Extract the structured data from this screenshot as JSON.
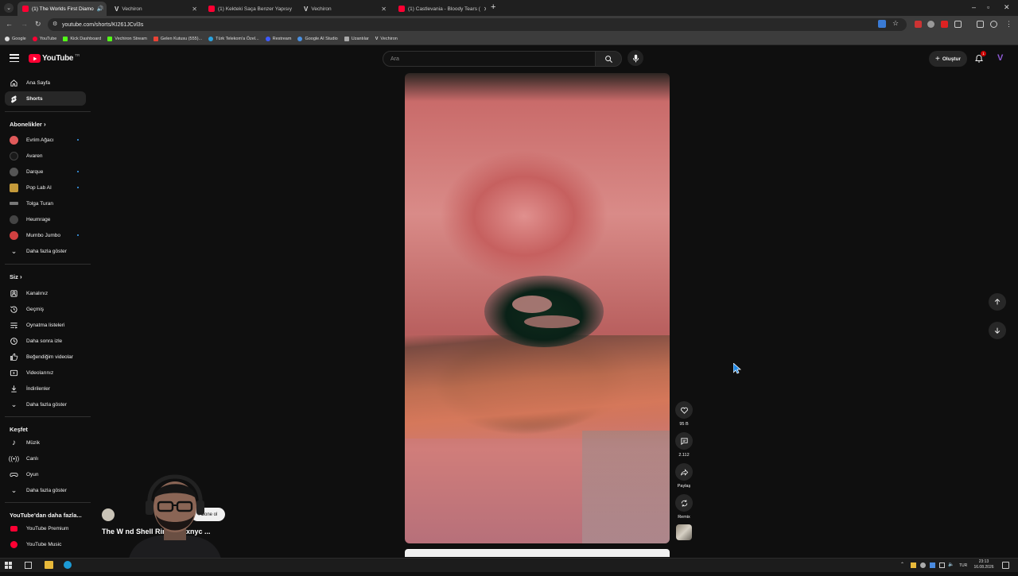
{
  "browser": {
    "tabs": [
      {
        "label": "(1) The Worlds First Diamo",
        "active": true
      },
      {
        "label": "Vechiron",
        "active": false
      },
      {
        "label": "(1) Kekteki Saça Benzer Yapısıy",
        "active": false
      },
      {
        "label": "Vechiron",
        "active": false
      },
      {
        "label": "(1) Castlevania - Bloody Tears (",
        "active": false
      }
    ],
    "url": "youtube.com/shorts/KI261JCvl3s",
    "bookmarks": [
      "Google",
      "YouTube",
      "Kick Dashboard",
      "Vechiron Stream",
      "Gelen Kutusu (555)...",
      "Türk Telekom'a Özel...",
      "Restream",
      "Google AI Studio",
      "Uzantılar",
      "Vechiron"
    ]
  },
  "youtube": {
    "logo": "YouTube",
    "logo_suffix": "TR",
    "search_placeholder": "Ara",
    "create_label": "Oluştur",
    "notification_count": "1"
  },
  "sidebar": {
    "main": [
      {
        "label": "Ana Sayfa",
        "icon": "home-icon"
      },
      {
        "label": "Shorts",
        "icon": "shorts-icon",
        "selected": true
      }
    ],
    "subscriptions_header": "Abonelikler",
    "subscriptions": [
      {
        "label": "Evrim Ağacı",
        "dot": true,
        "color": "#e05a5a"
      },
      {
        "label": "Avaren",
        "dot": false,
        "color": "#333333"
      },
      {
        "label": "Darque",
        "dot": true,
        "color": "#555555"
      },
      {
        "label": "Pop Lab AI",
        "dot": true,
        "color": "#c49a3a"
      },
      {
        "label": "Tolga Turan",
        "dot": false,
        "color": "#777777"
      },
      {
        "label": "Heumrage",
        "dot": false,
        "color": "#444444"
      },
      {
        "label": "Mumbo Jumbo",
        "dot": true,
        "color": "#d04040"
      }
    ],
    "subscriptions_more": "Daha fazla göster",
    "you_header": "Siz",
    "you": [
      {
        "label": "Kanalınız",
        "icon": "channel-icon"
      },
      {
        "label": "Geçmiş",
        "icon": "history-icon"
      },
      {
        "label": "Oynatma listeleri",
        "icon": "playlists-icon"
      },
      {
        "label": "Daha sonra izle",
        "icon": "watch-later-icon"
      },
      {
        "label": "Beğendiğim videolar",
        "icon": "like-icon"
      },
      {
        "label": "Videolarınız",
        "icon": "your-videos-icon"
      },
      {
        "label": "İndirilenler",
        "icon": "download-icon"
      }
    ],
    "you_more": "Daha fazla göster",
    "explore_header": "Keşfet",
    "explore": [
      {
        "label": "Müzik",
        "icon": "music-icon"
      },
      {
        "label": "Canlı",
        "icon": "live-icon"
      },
      {
        "label": "Oyun",
        "icon": "gaming-icon"
      }
    ],
    "explore_more": "Daha fazla göster",
    "more_header": "YouTube'dan daha fazla...",
    "more": [
      {
        "label": "YouTube Premium",
        "icon": "youtube-premium-icon"
      },
      {
        "label": "YouTube Music",
        "icon": "youtube-music-icon"
      }
    ]
  },
  "short": {
    "title": "The W                     nd Shell Ring #traxnyc ...",
    "subscribe_label": "Abone ol",
    "likes": "95 B",
    "comments": "2.112",
    "share_label": "Paylaş",
    "remix_label": "Remix"
  },
  "taskbar": {
    "lang": "TUR",
    "time": "23:13",
    "date": "16.08.2026"
  }
}
